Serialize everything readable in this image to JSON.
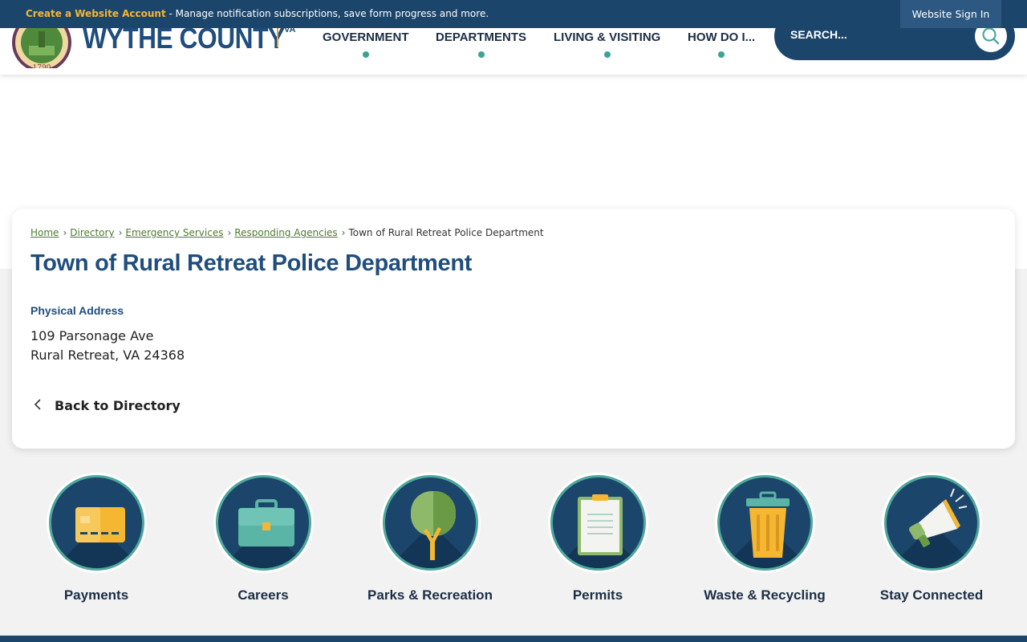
{
  "topbar": {
    "create_account_link": "Create a Website Account",
    "message": " - Manage notification subscriptions, save form progress and more.",
    "signin_label": "Website Sign In"
  },
  "header": {
    "brand_name": "WYTHE COUNTY",
    "brand_suffix": "VA",
    "nav": [
      {
        "label": "GOVERNMENT"
      },
      {
        "label": "DEPARTMENTS"
      },
      {
        "label": "LIVING & VISITING"
      },
      {
        "label": "HOW DO I..."
      }
    ],
    "search_placeholder": "SEARCH..."
  },
  "breadcrumb": {
    "items": [
      "Home",
      "Directory",
      "Emergency Services",
      "Responding Agencies"
    ],
    "current": "Town of Rural Retreat Police Department"
  },
  "page": {
    "title": "Town of Rural Retreat Police Department",
    "address_heading": "Physical Address",
    "address_line1": "109 Parsonage Ave",
    "address_line2": "Rural Retreat, VA 24368",
    "back_label": "Back to Directory"
  },
  "quick_links": [
    {
      "label": "Payments",
      "icon": "credit-card-icon"
    },
    {
      "label": "Careers",
      "icon": "briefcase-icon"
    },
    {
      "label": "Parks & Recreation",
      "icon": "tree-icon"
    },
    {
      "label": "Permits",
      "icon": "clipboard-icon"
    },
    {
      "label": "Waste & Recycling",
      "icon": "trash-can-icon"
    },
    {
      "label": "Stay Connected",
      "icon": "megaphone-icon"
    }
  ],
  "colors": {
    "navy": "#1c456b",
    "teal": "#4ea89b",
    "gold": "#f5b731",
    "link_green": "#4d7a2e"
  }
}
